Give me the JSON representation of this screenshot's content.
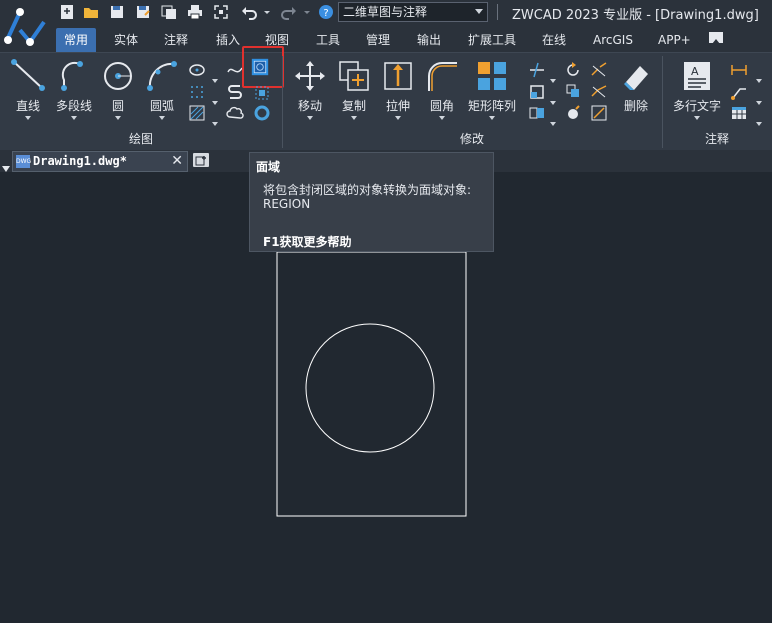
{
  "app": {
    "title": "ZWCAD 2023 专业版 - [Drawing1.dwg]",
    "workspace": "二维草图与注释"
  },
  "tabs": [
    "常用",
    "实体",
    "注释",
    "插入",
    "视图",
    "工具",
    "管理",
    "输出",
    "扩展工具",
    "在线",
    "ArcGIS",
    "APP+"
  ],
  "active_tab": "常用",
  "draw_panel": {
    "title": "绘图",
    "tools": [
      {
        "label": "直线",
        "icon": "line-icon"
      },
      {
        "label": "多段线",
        "icon": "polyline-icon"
      },
      {
        "label": "圆",
        "icon": "circle-icon"
      },
      {
        "label": "圆弧",
        "icon": "arc-icon"
      }
    ],
    "highlighted_tool": "region-icon"
  },
  "modify_panel": {
    "title": "修改",
    "tools": [
      {
        "label": "移动",
        "icon": "move-icon"
      },
      {
        "label": "复制",
        "icon": "copy-icon"
      },
      {
        "label": "拉伸",
        "icon": "stretch-icon"
      },
      {
        "label": "圆角",
        "icon": "fillet-icon"
      },
      {
        "label": "矩形阵列",
        "icon": "rect-array-icon"
      },
      {
        "label": "删除",
        "icon": "erase-icon"
      }
    ]
  },
  "annotation_panel": {
    "title": "注释",
    "tools": [
      {
        "label": "多行文字",
        "icon": "mtext-icon"
      }
    ]
  },
  "document_tab": {
    "label": "Drawing1.dwg*",
    "icon_text": "DWG"
  },
  "tooltip": {
    "title": "面域",
    "description": "将包含封闭区域的对象转换为面域对象:",
    "command": "REGION",
    "help": "F1获取更多帮助"
  },
  "colors": {
    "background": "#212830",
    "ribbon": "#323a45",
    "active_tab": "#3b6fb0",
    "highlight": "#e0312e",
    "icon_blue": "#4aa3df",
    "icon_orange": "#f0a030"
  }
}
